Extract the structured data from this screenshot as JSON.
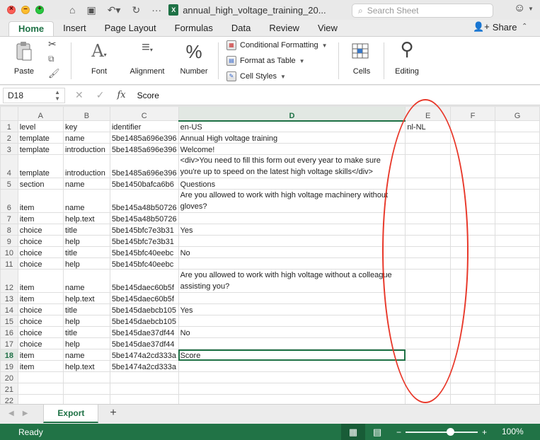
{
  "window": {
    "file_title": "annual_high_voltage_training_20...",
    "search_placeholder": "Search Sheet"
  },
  "ribbon_tabs": [
    "Home",
    "Insert",
    "Page Layout",
    "Formulas",
    "Data",
    "Review",
    "View"
  ],
  "share_label": "Share",
  "ribbon": {
    "paste": "Paste",
    "font": "Font",
    "alignment": "Alignment",
    "number": "Number",
    "conditional_formatting": "Conditional Formatting",
    "format_as_table": "Format as Table",
    "cell_styles": "Cell Styles",
    "cells": "Cells",
    "editing": "Editing"
  },
  "formula_bar": {
    "cell_ref": "D18",
    "fx": "fx",
    "value": "Score"
  },
  "grid": {
    "columns": [
      "A",
      "B",
      "C",
      "D",
      "E",
      "F",
      "G"
    ],
    "selected_column": "D",
    "selected_row": 18,
    "rows": [
      {
        "n": "1",
        "a": "level",
        "b": "key",
        "c": "identifier",
        "d": "en-US",
        "e": "nl-NL"
      },
      {
        "n": "2",
        "a": "template",
        "b": "name",
        "c": "5be1485a696e396",
        "d": "Annual High voltage training",
        "e": ""
      },
      {
        "n": "3",
        "a": "template",
        "b": "introduction",
        "c": "5be1485a696e396",
        "d": "Welcome!",
        "e": ""
      },
      {
        "n": "4",
        "a": "template",
        "b": "introduction",
        "c": "5be1485a696e396",
        "d": "<div>You need to fill this form out every year to make sure you're up to speed on the latest high voltage skills</div>",
        "e": "",
        "tall": true
      },
      {
        "n": "5",
        "a": "section",
        "b": "name",
        "c": "5be1450bafca6b6",
        "d": "Questions",
        "e": ""
      },
      {
        "n": "6",
        "a": "item",
        "b": "name",
        "c": "5be145a48b50726",
        "d": "Are you allowed to work with high voltage machinery without gloves?",
        "e": "",
        "tall": true
      },
      {
        "n": "7",
        "a": "item",
        "b": "help.text",
        "c": "5be145a48b50726",
        "d": "",
        "e": ""
      },
      {
        "n": "8",
        "a": "choice",
        "b": "title",
        "c": "5be145bfc7e3b31",
        "d": "Yes",
        "e": ""
      },
      {
        "n": "9",
        "a": "choice",
        "b": "help",
        "c": "5be145bfc7e3b31",
        "d": "",
        "e": ""
      },
      {
        "n": "10",
        "a": "choice",
        "b": "title",
        "c": "5be145bfc40eebc",
        "d": "No",
        "e": ""
      },
      {
        "n": "11",
        "a": "choice",
        "b": "help",
        "c": "5be145bfc40eebc",
        "d": "",
        "e": ""
      },
      {
        "n": "12",
        "a": "item",
        "b": "name",
        "c": "5be145daec60b5f",
        "d": "Are you allowed to work with high voltage without a colleague assisting you?",
        "e": "",
        "tall": true
      },
      {
        "n": "13",
        "a": "item",
        "b": "help.text",
        "c": "5be145daec60b5f",
        "d": "",
        "e": ""
      },
      {
        "n": "14",
        "a": "choice",
        "b": "title",
        "c": "5be145daebcb105",
        "d": "Yes",
        "e": ""
      },
      {
        "n": "15",
        "a": "choice",
        "b": "help",
        "c": "5be145daebcb105",
        "d": "",
        "e": ""
      },
      {
        "n": "16",
        "a": "choice",
        "b": "title",
        "c": "5be145dae37df44",
        "d": "No",
        "e": ""
      },
      {
        "n": "17",
        "a": "choice",
        "b": "help",
        "c": "5be145dae37df44",
        "d": "",
        "e": ""
      },
      {
        "n": "18",
        "a": "item",
        "b": "name",
        "c": "5be1474a2cd333a",
        "d": "Score",
        "e": ""
      },
      {
        "n": "19",
        "a": "item",
        "b": "help.text",
        "c": "5be1474a2cd333a",
        "d": "",
        "e": ""
      },
      {
        "n": "20",
        "a": "",
        "b": "",
        "c": "",
        "d": "",
        "e": ""
      },
      {
        "n": "21",
        "a": "",
        "b": "",
        "c": "",
        "d": "",
        "e": ""
      },
      {
        "n": "22",
        "a": "",
        "b": "",
        "c": "",
        "d": "",
        "e": ""
      }
    ]
  },
  "sheet_tabs": [
    "Export"
  ],
  "status": {
    "text": "Ready",
    "zoom": "100%",
    "zoom_minus": "−",
    "zoom_plus": "+"
  },
  "colors": {
    "accent": "#1e7145",
    "status_bar": "#217346",
    "annotation": "#e8382a"
  }
}
